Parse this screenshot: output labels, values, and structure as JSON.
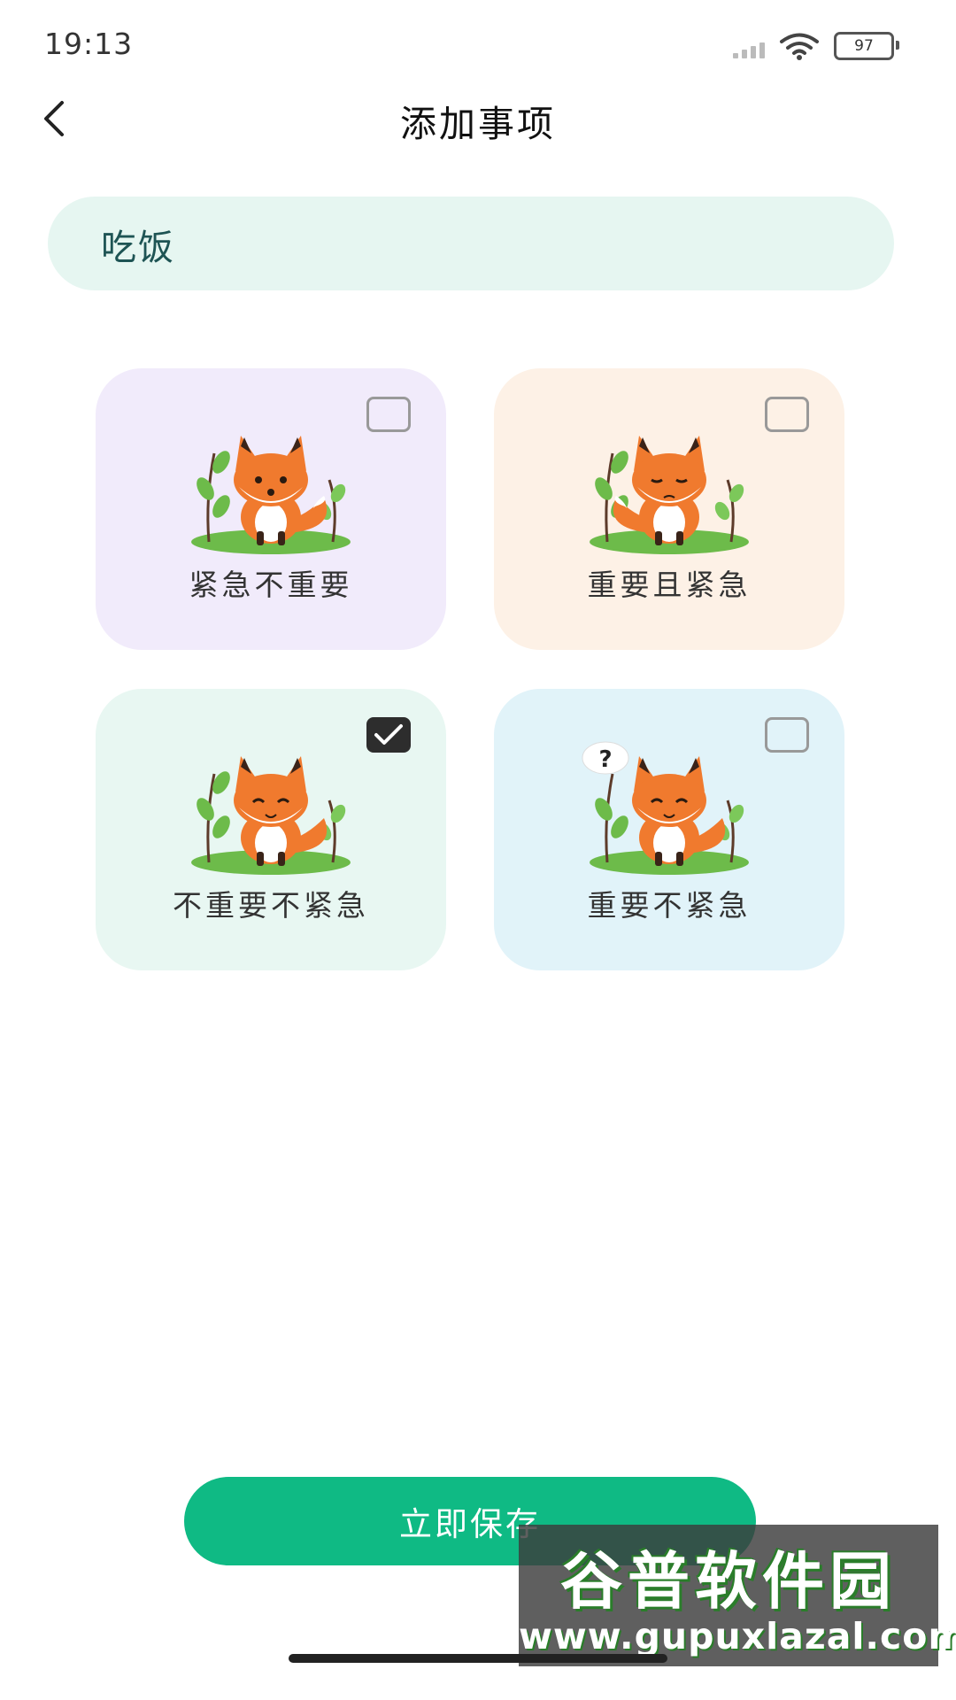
{
  "status_bar": {
    "time": "19:13",
    "battery": "97",
    "signal_icon": "signal-icon",
    "wifi_icon": "wifi-icon"
  },
  "header": {
    "title": "添加事项",
    "back_icon": "chevron-left-icon"
  },
  "task": {
    "value": "吃饭"
  },
  "categories": [
    {
      "label": "紧急不重要",
      "checked": false,
      "card_color": "#f1ebfb"
    },
    {
      "label": "重要且紧急",
      "checked": false,
      "card_color": "#fdf1e6"
    },
    {
      "label": "不重要不紧急",
      "checked": true,
      "card_color": "#e8f7f2"
    },
    {
      "label": "重要不紧急",
      "checked": false,
      "card_color": "#e1f3f9"
    }
  ],
  "save_button": {
    "label": "立即保存",
    "color": "#0fba84"
  },
  "watermark": {
    "title": "谷普软件园",
    "url": "www.gupuxlazal.com"
  }
}
